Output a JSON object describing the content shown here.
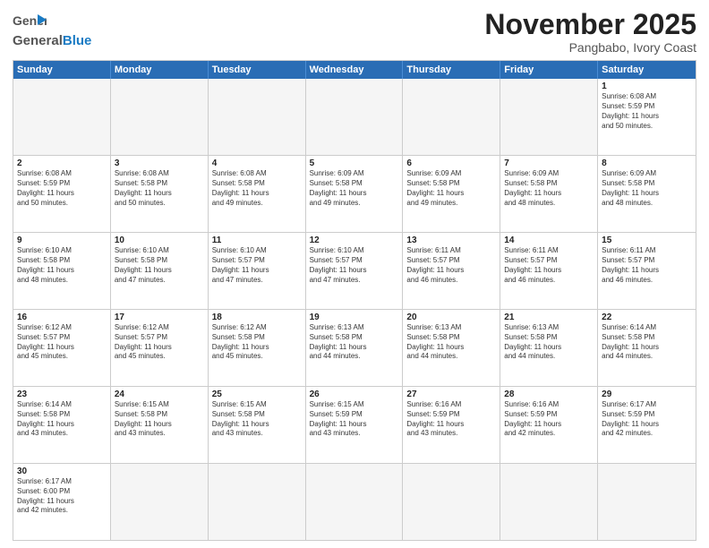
{
  "header": {
    "logo_general": "General",
    "logo_blue": "Blue",
    "month_title": "November 2025",
    "location": "Pangbabo, Ivory Coast"
  },
  "weekdays": [
    "Sunday",
    "Monday",
    "Tuesday",
    "Wednesday",
    "Thursday",
    "Friday",
    "Saturday"
  ],
  "rows": [
    [
      {
        "day": "",
        "info": "",
        "empty": true
      },
      {
        "day": "",
        "info": "",
        "empty": true
      },
      {
        "day": "",
        "info": "",
        "empty": true
      },
      {
        "day": "",
        "info": "",
        "empty": true
      },
      {
        "day": "",
        "info": "",
        "empty": true
      },
      {
        "day": "",
        "info": "",
        "empty": true
      },
      {
        "day": "1",
        "info": "Sunrise: 6:08 AM\nSunset: 5:59 PM\nDaylight: 11 hours\nand 50 minutes."
      }
    ],
    [
      {
        "day": "2",
        "info": "Sunrise: 6:08 AM\nSunset: 5:59 PM\nDaylight: 11 hours\nand 50 minutes."
      },
      {
        "day": "3",
        "info": "Sunrise: 6:08 AM\nSunset: 5:58 PM\nDaylight: 11 hours\nand 50 minutes."
      },
      {
        "day": "4",
        "info": "Sunrise: 6:08 AM\nSunset: 5:58 PM\nDaylight: 11 hours\nand 49 minutes."
      },
      {
        "day": "5",
        "info": "Sunrise: 6:09 AM\nSunset: 5:58 PM\nDaylight: 11 hours\nand 49 minutes."
      },
      {
        "day": "6",
        "info": "Sunrise: 6:09 AM\nSunset: 5:58 PM\nDaylight: 11 hours\nand 49 minutes."
      },
      {
        "day": "7",
        "info": "Sunrise: 6:09 AM\nSunset: 5:58 PM\nDaylight: 11 hours\nand 48 minutes."
      },
      {
        "day": "8",
        "info": "Sunrise: 6:09 AM\nSunset: 5:58 PM\nDaylight: 11 hours\nand 48 minutes."
      }
    ],
    [
      {
        "day": "9",
        "info": "Sunrise: 6:10 AM\nSunset: 5:58 PM\nDaylight: 11 hours\nand 48 minutes."
      },
      {
        "day": "10",
        "info": "Sunrise: 6:10 AM\nSunset: 5:58 PM\nDaylight: 11 hours\nand 47 minutes."
      },
      {
        "day": "11",
        "info": "Sunrise: 6:10 AM\nSunset: 5:57 PM\nDaylight: 11 hours\nand 47 minutes."
      },
      {
        "day": "12",
        "info": "Sunrise: 6:10 AM\nSunset: 5:57 PM\nDaylight: 11 hours\nand 47 minutes."
      },
      {
        "day": "13",
        "info": "Sunrise: 6:11 AM\nSunset: 5:57 PM\nDaylight: 11 hours\nand 46 minutes."
      },
      {
        "day": "14",
        "info": "Sunrise: 6:11 AM\nSunset: 5:57 PM\nDaylight: 11 hours\nand 46 minutes."
      },
      {
        "day": "15",
        "info": "Sunrise: 6:11 AM\nSunset: 5:57 PM\nDaylight: 11 hours\nand 46 minutes."
      }
    ],
    [
      {
        "day": "16",
        "info": "Sunrise: 6:12 AM\nSunset: 5:57 PM\nDaylight: 11 hours\nand 45 minutes."
      },
      {
        "day": "17",
        "info": "Sunrise: 6:12 AM\nSunset: 5:57 PM\nDaylight: 11 hours\nand 45 minutes."
      },
      {
        "day": "18",
        "info": "Sunrise: 6:12 AM\nSunset: 5:58 PM\nDaylight: 11 hours\nand 45 minutes."
      },
      {
        "day": "19",
        "info": "Sunrise: 6:13 AM\nSunset: 5:58 PM\nDaylight: 11 hours\nand 44 minutes."
      },
      {
        "day": "20",
        "info": "Sunrise: 6:13 AM\nSunset: 5:58 PM\nDaylight: 11 hours\nand 44 minutes."
      },
      {
        "day": "21",
        "info": "Sunrise: 6:13 AM\nSunset: 5:58 PM\nDaylight: 11 hours\nand 44 minutes."
      },
      {
        "day": "22",
        "info": "Sunrise: 6:14 AM\nSunset: 5:58 PM\nDaylight: 11 hours\nand 44 minutes."
      }
    ],
    [
      {
        "day": "23",
        "info": "Sunrise: 6:14 AM\nSunset: 5:58 PM\nDaylight: 11 hours\nand 43 minutes."
      },
      {
        "day": "24",
        "info": "Sunrise: 6:15 AM\nSunset: 5:58 PM\nDaylight: 11 hours\nand 43 minutes."
      },
      {
        "day": "25",
        "info": "Sunrise: 6:15 AM\nSunset: 5:58 PM\nDaylight: 11 hours\nand 43 minutes."
      },
      {
        "day": "26",
        "info": "Sunrise: 6:15 AM\nSunset: 5:59 PM\nDaylight: 11 hours\nand 43 minutes."
      },
      {
        "day": "27",
        "info": "Sunrise: 6:16 AM\nSunset: 5:59 PM\nDaylight: 11 hours\nand 43 minutes."
      },
      {
        "day": "28",
        "info": "Sunrise: 6:16 AM\nSunset: 5:59 PM\nDaylight: 11 hours\nand 42 minutes."
      },
      {
        "day": "29",
        "info": "Sunrise: 6:17 AM\nSunset: 5:59 PM\nDaylight: 11 hours\nand 42 minutes."
      }
    ],
    [
      {
        "day": "30",
        "info": "Sunrise: 6:17 AM\nSunset: 6:00 PM\nDaylight: 11 hours\nand 42 minutes."
      },
      {
        "day": "",
        "info": "",
        "empty": true
      },
      {
        "day": "",
        "info": "",
        "empty": true
      },
      {
        "day": "",
        "info": "",
        "empty": true
      },
      {
        "day": "",
        "info": "",
        "empty": true
      },
      {
        "day": "",
        "info": "",
        "empty": true
      },
      {
        "day": "",
        "info": "",
        "empty": true
      }
    ]
  ]
}
